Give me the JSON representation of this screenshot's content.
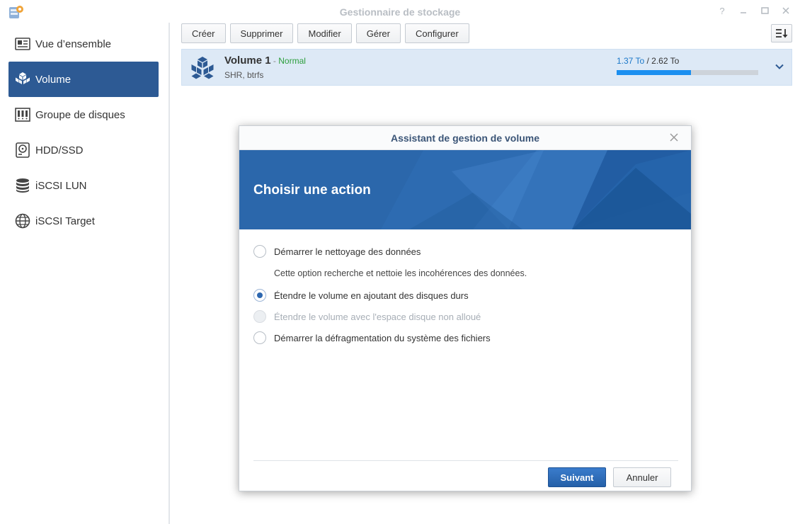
{
  "window": {
    "title": "Gestionnaire de stockage",
    "controls": [
      "help-icon",
      "minimize-icon",
      "maximize-icon",
      "close-icon"
    ]
  },
  "sidebar": {
    "items": [
      {
        "label": "Vue d’ensemble",
        "icon": "overview-icon",
        "active": false
      },
      {
        "label": "Volume",
        "icon": "volume-cubes-icon",
        "active": true
      },
      {
        "label": "Groupe de disques",
        "icon": "disk-group-icon",
        "active": false
      },
      {
        "label": "HDD/SSD",
        "icon": "hdd-icon",
        "active": false
      },
      {
        "label": "iSCSI LUN",
        "icon": "database-icon",
        "active": false
      },
      {
        "label": "iSCSI Target",
        "icon": "globe-icon",
        "active": false
      }
    ]
  },
  "toolbar": {
    "buttons": [
      "Créer",
      "Supprimer",
      "Modifier",
      "Gérer",
      "Configurer"
    ],
    "sort_icon": "sort-icon"
  },
  "volume": {
    "name": "Volume 1",
    "dash": " - ",
    "status": "Normal",
    "subtitle": "SHR, btrfs",
    "used": "1.37 To",
    "separator": " / ",
    "total": "2.62 To",
    "used_fraction": 0.523
  },
  "dialog": {
    "title": "Assistant de gestion de volume",
    "heading": "Choisir une action",
    "options": [
      {
        "label": "Démarrer le nettoyage des données",
        "checked": false,
        "disabled": false
      },
      {
        "label": "Étendre le volume en ajoutant des disques durs",
        "checked": true,
        "disabled": false
      },
      {
        "label": "Étendre le volume avec l'espace disque non alloué",
        "checked": false,
        "disabled": true
      },
      {
        "label": "Démarrer la défragmentation du système des fichiers",
        "checked": false,
        "disabled": false
      }
    ],
    "option0_description": "Cette option recherche et nettoie les incohérences des données.",
    "next_label": "Suivant",
    "cancel_label": "Annuler"
  },
  "colors": {
    "accent": "#2d5a94",
    "banner": "#2b67ab",
    "status_ok": "#2c9e3c",
    "usage_bar": "#1b8ff0"
  }
}
